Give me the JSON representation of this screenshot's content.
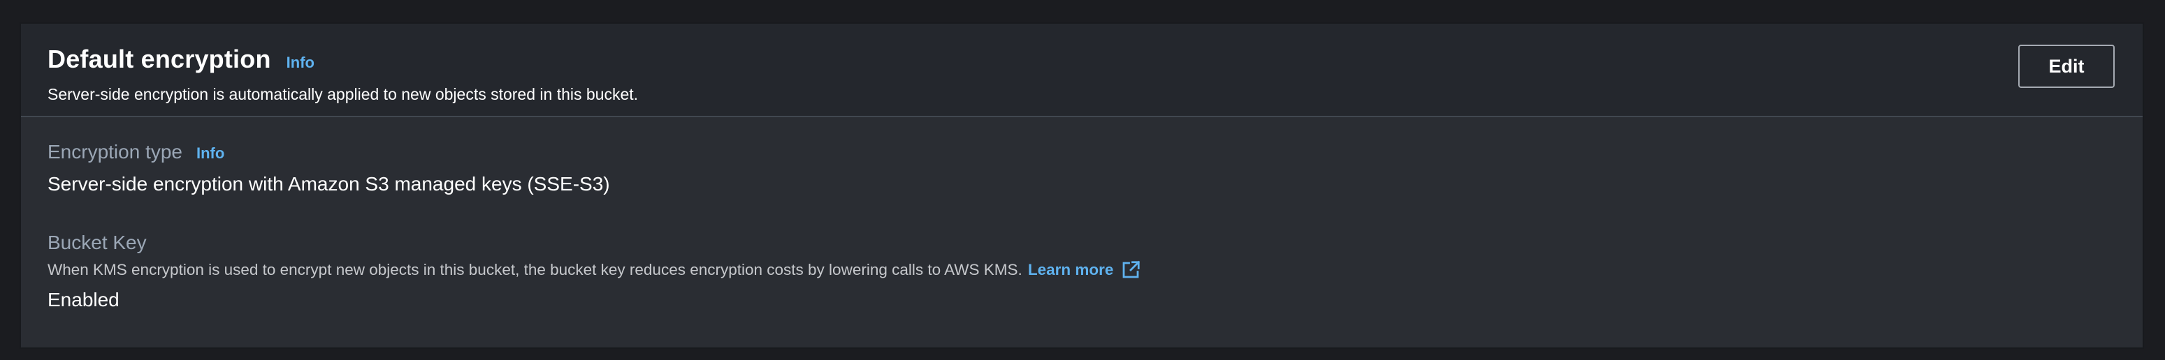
{
  "header": {
    "title": "Default encryption",
    "info_label": "Info",
    "subtitle": "Server-side encryption is automatically applied to new objects stored in this bucket.",
    "edit_label": "Edit"
  },
  "encryption_type": {
    "label": "Encryption type",
    "info_label": "Info",
    "value": "Server-side encryption with Amazon S3 managed keys (SSE-S3)"
  },
  "bucket_key": {
    "label": "Bucket Key",
    "description": "When KMS encryption is used to encrypt new objects in this bucket, the bucket key reduces encryption costs by lowering calls to AWS KMS.",
    "learn_more_label": "Learn more",
    "learn_more_icon": "external-link-icon",
    "value": "Enabled"
  },
  "colors": {
    "panel_background": "#2a2d33",
    "header_background": "#24272d",
    "link": "#5fb2ef",
    "label": "#9ba7b6",
    "text": "#ffffff"
  }
}
